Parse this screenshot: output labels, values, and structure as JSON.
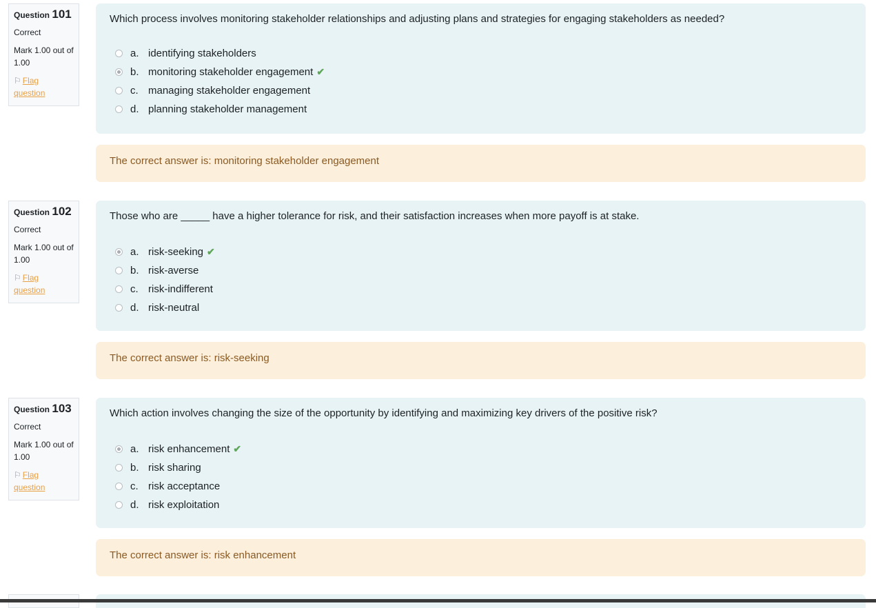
{
  "questions": [
    {
      "label": "Question",
      "number": "101",
      "state": "Correct",
      "grade": "Mark 1.00 out of 1.00",
      "flag_line1": "Flag",
      "flag_line2": "question",
      "text": "Which process involves monitoring stakeholder relationships and adjusting plans and strategies for engaging stakeholders as needed?",
      "answers": [
        {
          "letter": "a.",
          "text": "identifying stakeholders"
        },
        {
          "letter": "b.",
          "text": "monitoring stakeholder engagement"
        },
        {
          "letter": "c.",
          "text": "managing stakeholder engagement"
        },
        {
          "letter": "d.",
          "text": "planning stakeholder management"
        }
      ],
      "feedback": "The correct answer is: monitoring stakeholder engagement"
    },
    {
      "label": "Question",
      "number": "102",
      "state": "Correct",
      "grade": "Mark 1.00 out of 1.00",
      "flag_line1": "Flag",
      "flag_line2": "question",
      "text": "Those who are _____ have a higher tolerance for risk, and their satisfaction increases when more payoff is at stake.",
      "answers": [
        {
          "letter": "a.",
          "text": "risk-seeking"
        },
        {
          "letter": "b.",
          "text": "risk-averse"
        },
        {
          "letter": "c.",
          "text": "risk-indifferent"
        },
        {
          "letter": "d.",
          "text": "risk-neutral"
        }
      ],
      "feedback": "The correct answer is: risk-seeking"
    },
    {
      "label": "Question",
      "number": "103",
      "state": "Correct",
      "grade": "Mark 1.00 out of 1.00",
      "flag_line1": "Flag",
      "flag_line2": "question",
      "text": "Which action involves changing the size of the opportunity by identifying and maximizing key drivers of the positive risk?",
      "answers": [
        {
          "letter": "a.",
          "text": "risk enhancement"
        },
        {
          "letter": "b.",
          "text": "risk sharing"
        },
        {
          "letter": "c.",
          "text": "risk acceptance"
        },
        {
          "letter": "d.",
          "text": "risk exploitation"
        }
      ],
      "feedback": "The correct answer is: risk enhancement"
    }
  ],
  "selected": [
    "b.",
    "a.",
    "a."
  ],
  "icons": {
    "flag": "flag-outline-icon",
    "tick": "check-icon"
  },
  "colors": {
    "question_bg": "#e7f3f5",
    "feedback_bg": "#fcefdc",
    "feedback_text": "#8a5a22",
    "tick": "#5fa55a",
    "flag_link": "#e8a045"
  }
}
